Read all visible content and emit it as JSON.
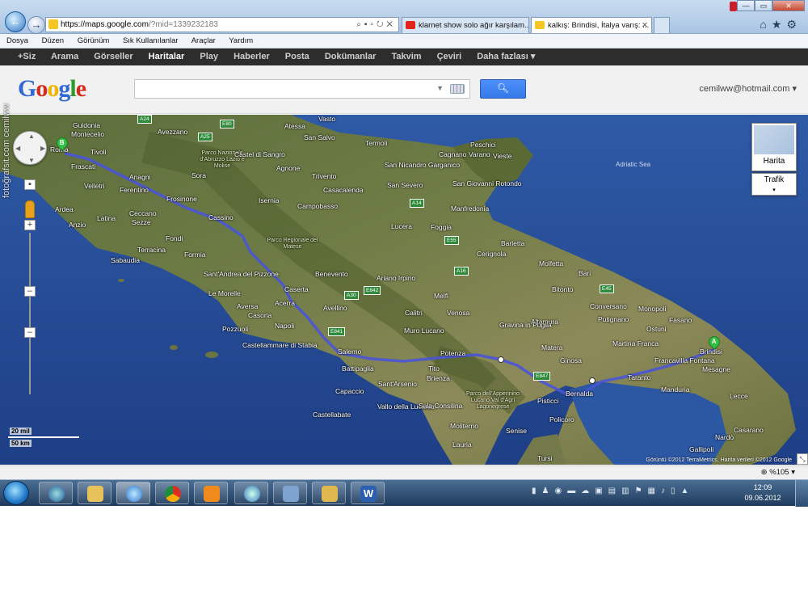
{
  "browser": {
    "url_host": "https://maps.google.com",
    "url_rest": "/?mid=1339232183",
    "tabs": [
      {
        "label": "klarnet show solo ağır karşılam...",
        "icon": "youtube-icon"
      },
      {
        "label": "kalkış: Brindisi, İtalya varış: ...",
        "icon": "google-maps-icon"
      }
    ],
    "menu": [
      "Dosya",
      "Düzen",
      "Görünüm",
      "Sık Kullanılanlar",
      "Araçlar",
      "Yardım"
    ],
    "status_zoom": "%105",
    "colors": {
      "chrome": "#a9c4e3",
      "map_sea": "#274d95",
      "route": "#4a55d6"
    }
  },
  "google_bar": {
    "items": [
      "+Siz",
      "Arama",
      "Görseller",
      "Haritalar",
      "Play",
      "Haberler",
      "Posta",
      "Dokümanlar",
      "Takvim",
      "Çeviri",
      "Daha fazlası ▾"
    ],
    "active": "Haritalar"
  },
  "header": {
    "logo": "Google",
    "account": "cemilww@hotmail.com ▾",
    "search_placeholder": ""
  },
  "map": {
    "controls": {
      "map_type": "Harita",
      "traffic": "Trafik",
      "scale_mi": "20 mil",
      "scale_km": "50 km"
    },
    "markers": [
      {
        "label": "A",
        "place": "Brindisi"
      },
      {
        "label": "B",
        "place": "Roma"
      }
    ],
    "sea_labels": [
      "Adriatic Sea"
    ],
    "places": [
      "Guidonia",
      "Montecelio",
      "Tivoli",
      "Roma",
      "Frascati",
      "Velletri",
      "Ferentino",
      "Anagni",
      "Frosinone",
      "Latina",
      "Ardea",
      "Anzio",
      "Ceccano",
      "Sezze",
      "Cassino",
      "Fondi",
      "Formia",
      "Terracina",
      "Sabaudia",
      "Avezzano",
      "Sora",
      "Isernia",
      "Campobasso",
      "Lucera",
      "Foggia",
      "Barletta",
      "Bari",
      "Molfetta",
      "Bitonto",
      "Monopoli",
      "Cerignola",
      "Manfredonia",
      "San Severo",
      "Caserta",
      "Acerra",
      "Aversa",
      "Napoli",
      "Pozzuoli",
      "Casoria",
      "Benevento",
      "Avellino",
      "Salerno",
      "Battipaglia",
      "Castellammare di Stabia",
      "Potenza",
      "Matera",
      "Altamura",
      "Gravina in Puglia",
      "Melfi",
      "Venosa",
      "Taranto",
      "Martina Franca",
      "Francavilla Fontana",
      "Brindisi",
      "Mesagne",
      "Lecce",
      "Manduria",
      "Nardò",
      "Gallipoli",
      "Casarano",
      "Ginosa",
      "Bernalda",
      "Pisticci",
      "Policoro",
      "Capaccio",
      "Sant'Arsenio",
      "Vallo della Lucania",
      "Castellabate",
      "Sala Consilina",
      "Lauria",
      "Tito",
      "Brienza",
      "Moliterno",
      "Senise",
      "Conversano",
      "Fasano",
      "Putignano",
      "Ostuni",
      "Vasto",
      "Termoli",
      "Atessa",
      "San Salvo",
      "Agnone",
      "Trivento",
      "Casacalenda",
      "Castel di Sangro",
      "Peschici",
      "Vieste",
      "San Giovanni Rotondo",
      "Cagnano Varano",
      "San Nicandro Garganico",
      "Ariano Irpino",
      "Calitri",
      "Muro Lucano",
      "Sant'Andrea del Pizzone",
      "Le Morelle",
      "Tursi"
    ],
    "park_labels": [
      "Parco Nazionale d'Abruzzo Lazio e Molise",
      "Parco Regionale del Matese",
      "Parco dell'Appennino Lucano Val d'Agri Lagonegrese"
    ],
    "road_shields": [
      "A24",
      "A25",
      "E80",
      "A14",
      "E55",
      "A16",
      "E842",
      "A30",
      "E841",
      "E847",
      "E45"
    ],
    "attribution": "Görüntü ©2012 TerraMetrics, Harita verileri ©2012 Google"
  },
  "taskbar": {
    "apps": [
      "google-earth-icon",
      "file-explorer-icon",
      "internet-explorer-icon",
      "chrome-icon",
      "media-player-icon",
      "network-icon",
      "computer-icon",
      "folder-icon",
      "word-icon"
    ],
    "time": "12:09",
    "date": "09.06.2012"
  },
  "watermark": "fotoğrafsit.com cemilww"
}
